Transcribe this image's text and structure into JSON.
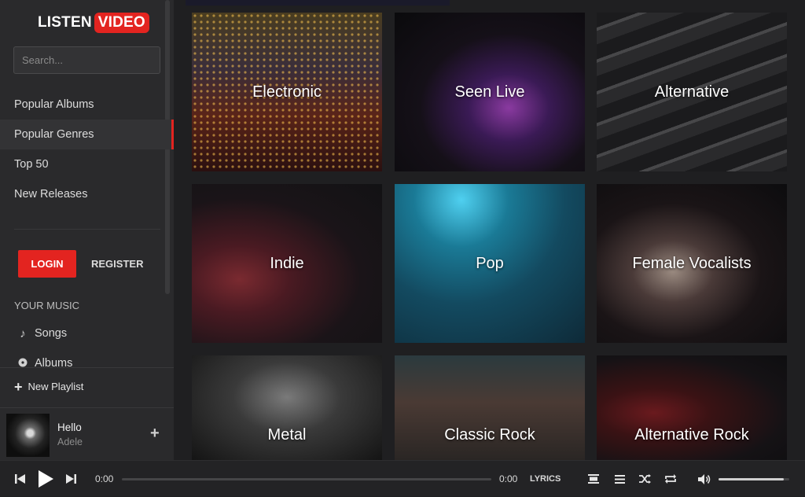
{
  "brand": {
    "part1": "LISTEN",
    "part2": "VIDEO",
    "accent": "#e32420"
  },
  "search": {
    "placeholder": "Search..."
  },
  "nav": [
    {
      "label": "Popular Albums",
      "active": false
    },
    {
      "label": "Popular Genres",
      "active": true
    },
    {
      "label": "Top 50",
      "active": false
    },
    {
      "label": "New Releases",
      "active": false
    }
  ],
  "auth": {
    "login_label": "LOGIN",
    "register_label": "REGISTER"
  },
  "your_music": {
    "heading": "YOUR MUSIC",
    "items": [
      {
        "label": "Songs",
        "icon": "music-note-icon"
      },
      {
        "label": "Albums",
        "icon": "album-disc-icon"
      }
    ]
  },
  "new_playlist_label": "New Playlist",
  "now_playing": {
    "title": "Hello",
    "artist": "Adele"
  },
  "genres": [
    "Electronic",
    "Seen Live",
    "Alternative",
    "Indie",
    "Pop",
    "Female Vocalists",
    "Metal",
    "Classic Rock",
    "Alternative Rock"
  ],
  "player": {
    "current_time": "0:00",
    "duration": "0:00",
    "lyrics_label": "LYRICS",
    "progress": 0,
    "volume": 0.92,
    "icons": [
      "previous-icon",
      "play-icon",
      "next-icon",
      "video-toggle-icon",
      "queue-icon",
      "shuffle-icon",
      "repeat-icon",
      "volume-icon"
    ]
  }
}
